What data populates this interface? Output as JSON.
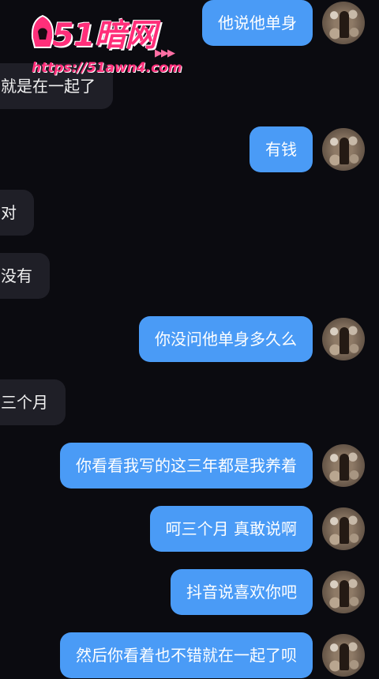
{
  "watermark": {
    "logo_text": "51暗网",
    "url_text": "https://51awn4.com",
    "arrows": "▶▶▶"
  },
  "messages": [
    {
      "side": "out",
      "text": "他说他单身"
    },
    {
      "side": "in",
      "text": "就是在一起了"
    },
    {
      "side": "out",
      "text": "有钱"
    },
    {
      "side": "in",
      "text": "对"
    },
    {
      "side": "in",
      "text": "没有"
    },
    {
      "side": "out",
      "text": "你没问他单身多久么"
    },
    {
      "side": "in",
      "text": "三个月"
    },
    {
      "side": "out",
      "text": "你看看我写的这三年都是我养着"
    },
    {
      "side": "out",
      "text": "呵三个月 真敢说啊"
    },
    {
      "side": "out",
      "text": "抖音说喜欢你吧"
    },
    {
      "side": "out",
      "text": "然后你看着也不错就在一起了呗"
    }
  ]
}
